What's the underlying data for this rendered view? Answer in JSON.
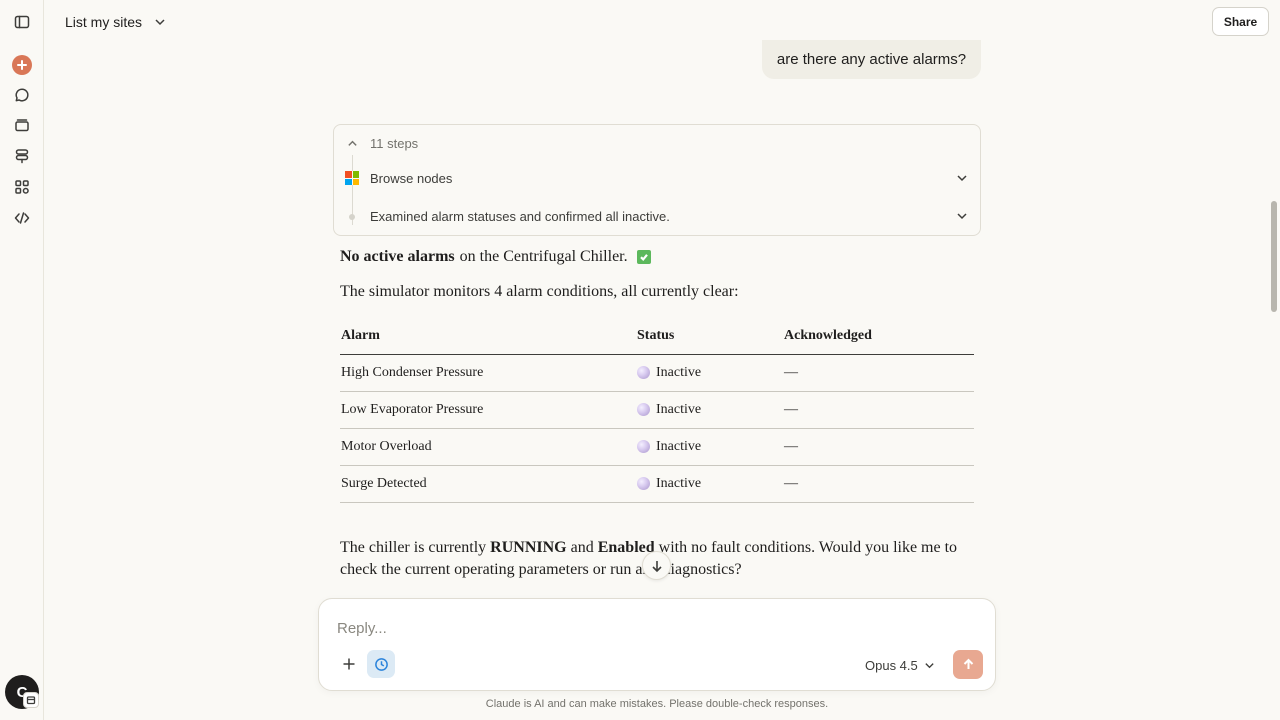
{
  "header": {
    "title": "List my sites",
    "share_label": "Share"
  },
  "rail": {
    "icons": [
      "sidebar-toggle-icon",
      "new-chat-icon",
      "chats-icon",
      "projects-icon",
      "artifacts-icon",
      "apps-icon",
      "code-icon"
    ],
    "avatar_letter": "C"
  },
  "conversation": {
    "user_message": "are there any active alarms?",
    "steps": {
      "count_label": "11 steps",
      "browse_label": "Browse nodes",
      "examined_label": "Examined alarm statuses and confirmed all inactive."
    },
    "response": {
      "line1_bold": "No active alarms",
      "line1_rest": "on the Centrifugal Chiller.",
      "line2": "The simulator monitors 4 alarm conditions, all currently clear:",
      "table": {
        "headers": [
          "Alarm",
          "Status",
          "Acknowledged"
        ],
        "rows": [
          {
            "alarm": "High Condenser Pressure",
            "status": "Inactive",
            "ack": "—"
          },
          {
            "alarm": "Low Evaporator Pressure",
            "status": "Inactive",
            "ack": "—"
          },
          {
            "alarm": "Motor Overload",
            "status": "Inactive",
            "ack": "—"
          },
          {
            "alarm": "Surge Detected",
            "status": "Inactive",
            "ack": "—"
          }
        ]
      },
      "para_1": "The chiller is currently ",
      "para_running": "RUNNING",
      "para_2": " and ",
      "para_enabled": "Enabled",
      "para_3": " with no fault conditions. Would you like me to check the current operating parameters or run any diagnostics?"
    }
  },
  "composer": {
    "placeholder": "Reply...",
    "model": "Opus 4.5"
  },
  "footer": {
    "disclaimer": "Claude is AI and can make mistakes. Please double-check responses."
  },
  "colors": {
    "accent": "#d97757",
    "background": "#faf9f5",
    "send_disabled": "#e8a891",
    "check_green": "#5cb85c",
    "ms_red": "#f25022",
    "ms_green": "#7fba00",
    "ms_blue": "#00a4ef",
    "ms_yellow": "#ffb900"
  }
}
